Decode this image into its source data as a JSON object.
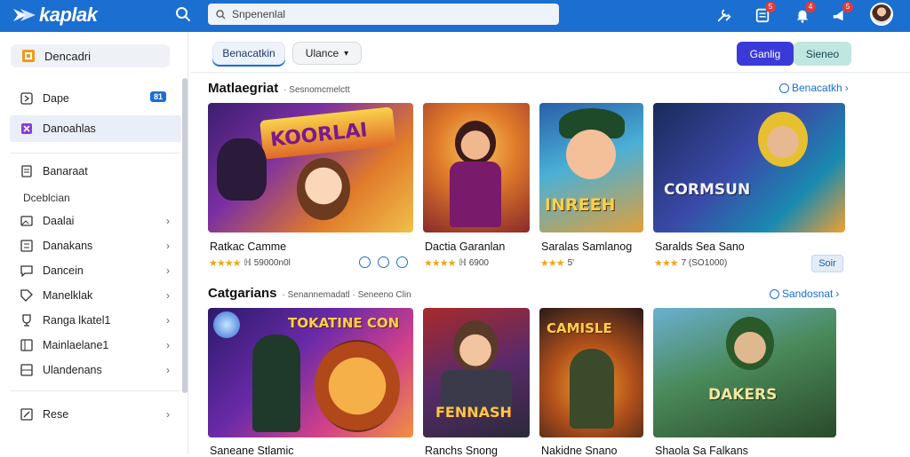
{
  "header": {
    "logo_text": "kaplak",
    "search_placeholder": "Snpenenlal",
    "notif_badges": [
      "5",
      "4",
      "5"
    ]
  },
  "sidebar": {
    "home_label": "Dencadri",
    "items_top": [
      {
        "label": "Dape",
        "icon": "page-icon",
        "count": "81"
      },
      {
        "label": "Danoahlas",
        "icon": "puzzle-icon"
      }
    ],
    "item_mid": {
      "label": "Banaraat",
      "icon": "document-icon"
    },
    "section_heading": "Dceblcian",
    "items": [
      {
        "label": "Daalai",
        "icon": "image-icon"
      },
      {
        "label": "Danakans",
        "icon": "list-icon"
      },
      {
        "label": "Dancein",
        "icon": "chat-icon"
      },
      {
        "label": "Manelklak",
        "icon": "tag-icon"
      },
      {
        "label": "Ranga lkatel1",
        "icon": "trophy-icon"
      },
      {
        "label": "Mainlaelane1",
        "icon": "folder-icon"
      },
      {
        "label": "Ulandenans",
        "icon": "grid-icon"
      }
    ],
    "footer_item": {
      "label": "Rese",
      "icon": "edit-icon"
    }
  },
  "filters": {
    "chip_active": "Benacatkin",
    "chip_dropdown": "Ulance",
    "btn_primary": "Ganlig",
    "btn_secondary": "Sieneo"
  },
  "sections": [
    {
      "title": "Matlaegriat",
      "subtitle": "· Sesnomcmelctt",
      "link": "Benacatkh",
      "cards": [
        {
          "title": "Ratkac Camme",
          "stars": "★★★★",
          "meta": "ℍ 59000n0l",
          "art_text": "KOORLAI"
        },
        {
          "title": "Dactia Garanlan",
          "stars": "★★★★",
          "meta": "ℍ 6900",
          "art_text": ""
        },
        {
          "title": "Saralas Samlanog",
          "stars": "★★★",
          "meta": "5'",
          "art_text": "INREEH"
        },
        {
          "title": "Saralds Sea Sano",
          "stars": "★★★",
          "meta": "7 (SO1000)",
          "art_text": "CORMSUN",
          "action": "Soir"
        }
      ]
    },
    {
      "title": "Catgarians",
      "subtitle": "· Senannemadatl · Seneeno Clin",
      "link": "Sandosnat",
      "cards": [
        {
          "title": "Saneane Stlamic",
          "art_text": "TOKATINE CON"
        },
        {
          "title": "Ranchs Snong",
          "art_text": "FENNASH"
        },
        {
          "title": "Nakidne Snano",
          "art_text": "CAMISLE"
        },
        {
          "title": "Shaola Sa Falkans",
          "art_text": "DAKERS"
        }
      ]
    }
  ],
  "colors": {
    "accent": "#1a6fd0",
    "primary_button": "#3a3ad8",
    "secondary_button": "#bfe6df",
    "star": "#f0a417"
  }
}
